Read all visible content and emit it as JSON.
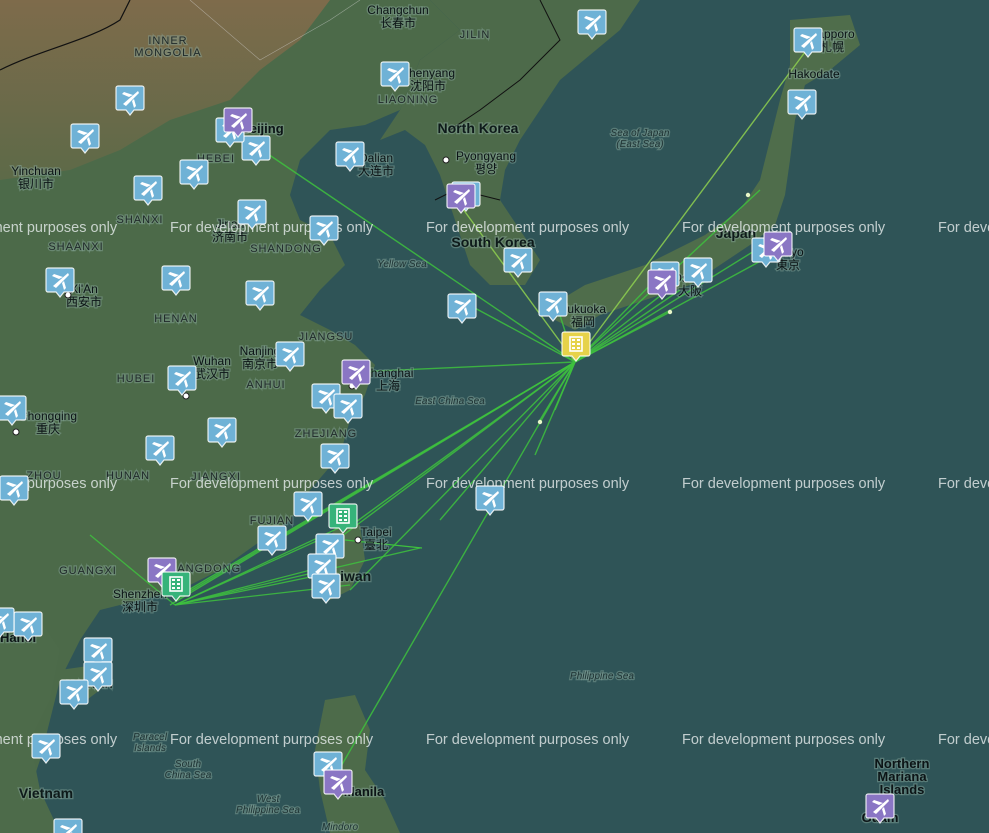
{
  "watermark": "For development purposes only",
  "labels": {
    "inner_mongolia": "INNER\nMONGOLIA",
    "changchun": "Changchun\n长春市",
    "jilin": "JILIN",
    "sapporo": "Sapporo\n札幌",
    "hakodate": "Hakodate",
    "shenyang": "Shenyang\n沈阳市",
    "liaoning": "LIAONING",
    "north_korea": "North Korea",
    "sea_of_japan": "Sea of Japan\n(East Sea)",
    "yinchuan": "Yinchuan\n银川市",
    "dalian": "Dalian\n大连市",
    "pyongyang": "Pyongyang\n평양",
    "beijing": "Beijing",
    "hebei": "HEBEI",
    "shanxi": "SHANXI",
    "shaanxi": "SHAANXI",
    "jinan": "Jinan\n济南市",
    "shandong": "SHANDONG",
    "south_korea": "South Korea",
    "japan": "Japan",
    "tokyo": "Tokyo\n東京",
    "osaka": "Osaka\n大阪",
    "yellow_sea": "Yellow Sea",
    "xian": "Xi'An\n西安市",
    "henan": "HENAN",
    "fukuoka": "Fukuoka\n福岡",
    "jiangsu": "JIANGSU",
    "nanjing": "Nanjing\n南京市",
    "shanghai": "Shanghai\n上海",
    "hubei": "HUBEI",
    "wuhan": "Wuhan\n武汉市",
    "anhui": "ANHUI",
    "chongqing": "Chongqing\n重庆",
    "east_china_sea": "East China Sea",
    "zhejiang": "ZHEJIANG",
    "hunan": "HUNAN",
    "jiangxi": "JIANGXI",
    "guizhou": "ZHOU",
    "fujian": "FUJIAN",
    "taipei": "Taipei\n臺北",
    "taiwan": "Taiwan",
    "guangxi": "GUANGXI",
    "guangdong": "GUANGDONG",
    "shenzhen": "Shenzhen\n深圳市",
    "hanoi": "Hanoi",
    "hainan": "HAINAN",
    "philippine_sea": "Philippine Sea",
    "paracel": "Paracel\nIslands",
    "south_china_sea": "South\nChina Sea",
    "west_philippine_sea": "West\nPhilippine Sea",
    "vietnam": "Vietnam",
    "manila": "Manila",
    "mindoro": "Mindoro",
    "northern_mariana": "Northern\nMariana\nIslands",
    "guam": "Guam"
  },
  "colors": {
    "water": "#2f5457",
    "land_china": "#4d6b4a",
    "land_desert": "#7d6b4b",
    "land_japan": "#4f6f4c",
    "route": "#3ec23e",
    "route_alt": "#8fd14f",
    "airport_marker": "#6fb2d6",
    "airport_selected_marker": "#8a76c4",
    "hub_marker": "#e6d24a",
    "office_marker": "#36b37a"
  },
  "markers": {
    "hub": {
      "name": "hub-building-marker",
      "icon": "building-icon"
    },
    "offices": [
      "office-taipei",
      "office-shenzhen"
    ],
    "airport_icon": "airplane-icon"
  }
}
